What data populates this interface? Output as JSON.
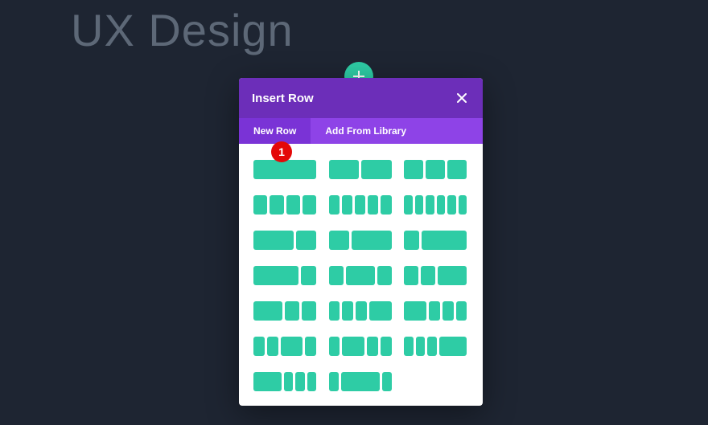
{
  "page": {
    "heading": "UX Design"
  },
  "modal": {
    "title": "Insert Row",
    "tabs": {
      "new_row": "New Row",
      "add_from_library": "Add From Library"
    },
    "badge": "1",
    "layouts": [
      [
        1
      ],
      [
        1,
        1
      ],
      [
        1,
        1,
        1
      ],
      [
        1,
        1,
        1,
        1
      ],
      [
        1,
        1,
        1,
        1,
        1
      ],
      [
        1,
        1,
        1,
        1,
        1,
        1
      ],
      [
        2,
        1
      ],
      [
        1,
        2
      ],
      [
        1,
        3
      ],
      [
        3,
        1
      ],
      [
        1,
        2,
        1
      ],
      [
        1,
        1,
        2
      ],
      [
        2,
        1,
        1
      ],
      [
        1,
        1,
        1,
        2
      ],
      [
        2,
        1,
        1,
        1
      ],
      [
        1,
        1,
        2,
        1
      ],
      [
        1,
        2,
        1,
        1
      ],
      [
        1,
        1,
        1,
        3
      ],
      [
        3,
        1,
        1,
        1
      ],
      [
        1,
        4,
        1
      ]
    ]
  },
  "colors": {
    "bg": "#1e2532",
    "heading": "#5d6877",
    "fab": "#2ecca5",
    "modal_header": "#6c2eb9",
    "modal_tabs": "#8e43e7",
    "tab_active": "#7a33d6",
    "badge": "#e40808",
    "col": "#2ecca5"
  }
}
